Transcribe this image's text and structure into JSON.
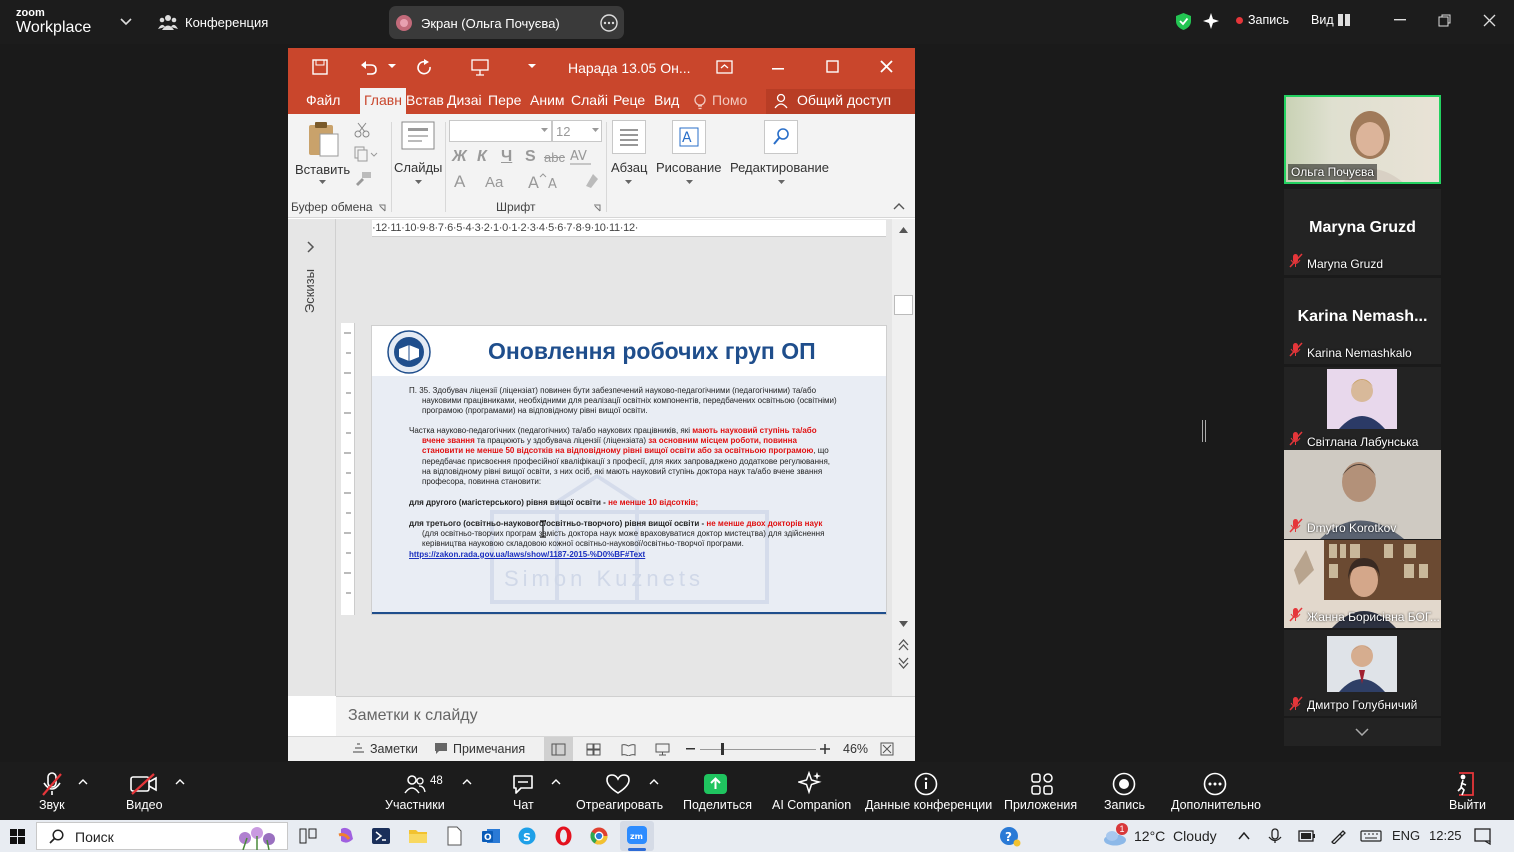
{
  "zoom": {
    "logo_line1": "zoom",
    "logo_line2": "Workplace",
    "meeting_label": "Конференция",
    "share_label": "Экран (Ольга Почуєва)",
    "record_label": "Запись",
    "view_label": "Вид"
  },
  "ppt": {
    "doc_title": "Нарада 13.05 Он...",
    "tabs": [
      "Файл",
      "Главн",
      "Встав",
      "Дизаі",
      "Пере",
      "Аним",
      "Слайі",
      "Реце",
      "Вид"
    ],
    "tell_me": "Помо",
    "share_label": "Общий доступ",
    "ribbon": {
      "paste": "Вставить",
      "slides": "Слайды",
      "font_size": "12",
      "paragraph": "Абзац",
      "drawing": "Рисование",
      "editing": "Редактирование",
      "clipboard_group": "Буфер обмена",
      "font_group": "Шрифт",
      "bold": "Ж",
      "italic": "К",
      "underline": "Ч",
      "shadow": "S",
      "strike": "abc",
      "font_a": "A",
      "change_case": "Aa"
    },
    "thumbnails_label": "Эскизы",
    "ruler_text": "·12·11·10·9·8·7·6·5·4·3·2·1·0·1·2·3·4·5·6·7·8·9·10·11·12·",
    "slide": {
      "title": "Оновлення робочих груп ОП",
      "p1": "П. 35. Здобувач ліцензії (ліцензіат) повинен бути забезпечений науково-педагогічними (педагогічними) та/або",
      "p1b": "науковими працівниками, необхідними для реалізації освітніх компонентів, передбачених освітньою (освітніми)",
      "p1c": "програмою (програмами) на відповідному рівні вищої освіти.",
      "p2a": "Частка науково-педагогічних (педагогічних) та/або наукових працівників, які ",
      "p2a_red": "мають науковий ступінь та/або",
      "p2b_red": "вчене звання",
      "p2b": " та працюють у здобувача ліцензії (ліцензіата) ",
      "p2b_red2": "за основним місцем роботи, повинна",
      "p2c_red": "становити не менше 50 відсотків на відповідному рівні вищої освіти або за освітньою програмою",
      "p2c": ", що",
      "p2d": "передбачає присвоєння професійної кваліфікації з професії, для яких запроваджено додаткове регулювання,",
      "p2e": "на відповідному рівні вищої освіти, з них осіб, які мають науковий ступінь доктора наук та/або вчене звання",
      "p2f": "професора, повинна становити:",
      "p3": "для другого (магістерського) рівня вищої освіти - ",
      "p3_red": "не менше 10 відсотків;",
      "p4": "для третього (освітньо-наукового/освітньо-творчого) рівня вищої освіти - ",
      "p4_red": "не менше двох докторів наук",
      "p4b": "(для освітньо-творчих програм замість доктора наук може враховуватися доктор мистецтва) для здійснення",
      "p4c": "керівництва науковою складовою кожної освітньо-наукової/освітньо-творчої програми.",
      "link": "https://zakon.rada.gov.ua/laws/show/1187-2015-%D0%BF#Text",
      "watermark": "Simon Kuznets"
    },
    "notes_placeholder": "Заметки к слайду",
    "status": {
      "notes": "Заметки",
      "comments": "Примечания",
      "zoom": "46%"
    }
  },
  "participants": [
    {
      "name": "Ольга Почуєва",
      "big": ""
    },
    {
      "name": "Maryna Gruzd",
      "big": "Maryna Gruzd"
    },
    {
      "name": "Karina Nemashkalo",
      "big": "Karina  Nemash..."
    },
    {
      "name": "Світлана Лабунська",
      "big": ""
    },
    {
      "name": "Dmytro Korotkov",
      "big": ""
    },
    {
      "name": "Жанна Борисівна БОГ...",
      "big": ""
    },
    {
      "name": "Дмитро Голубничий",
      "big": ""
    }
  ],
  "toolbar": {
    "audio": "Звук",
    "video": "Видео",
    "participants": "Участники",
    "participants_count": "48",
    "chat": "Чат",
    "react": "Отреагировать",
    "share": "Поделиться",
    "ai": "AI Companion",
    "info": "Данные конференции",
    "apps": "Приложения",
    "record": "Запись",
    "more": "Дополнительно",
    "leave": "Выйти"
  },
  "taskbar": {
    "search": "Поиск",
    "weather": "12°C  Cloudy",
    "weather_badge": "1",
    "lang": "ENG",
    "time": "12:25"
  }
}
